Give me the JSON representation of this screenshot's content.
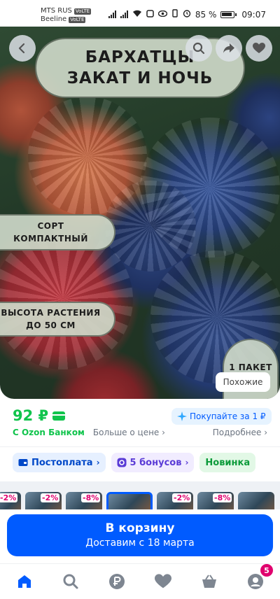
{
  "status_bar": {
    "carrier1": "MTS RUS",
    "carrier2": "Beeline",
    "volte": "VoLTE",
    "battery": "85 %",
    "time": "09:07"
  },
  "hero": {
    "title_line1": "БАРХАТЦЫ",
    "title_line2": "ЗАКАТ И НОЧЬ",
    "variety_line1": "СОРТ",
    "variety_line2": "КОМПАКТНЫЙ",
    "height_line1": "ВЫСОТА РАСТЕНИЯ",
    "height_line2": "ДО 50 СМ",
    "packet": "1 ПАКЕТ",
    "similar": "Похожие"
  },
  "price": {
    "value": "92 ₽",
    "promo": "Покупайте за 1 ₽",
    "bank": "С Ozon Банком",
    "more": "Больше о цене ›",
    "details": "Подробнее ›"
  },
  "tags": {
    "postpay": "Постоплата",
    "bonus": "5 бонусов",
    "new": "Новинка"
  },
  "carousel": {
    "discounts": [
      "-2%",
      "-2%",
      "-8%",
      "",
      "-2%",
      "-8%"
    ]
  },
  "cart": {
    "title": "В корзину",
    "subtitle": "Доставим с 18 марта"
  },
  "nav": {
    "profile_badge": "5"
  },
  "colors": {
    "accent": "#005bff",
    "price_green": "#10c44c",
    "discount": "#e0006e"
  }
}
